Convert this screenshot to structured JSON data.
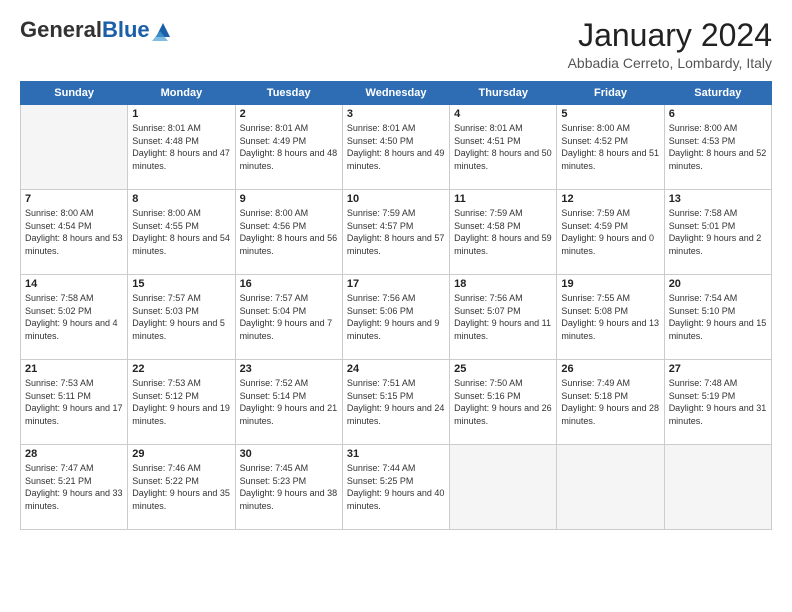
{
  "header": {
    "logo_general": "General",
    "logo_blue": "Blue",
    "month": "January 2024",
    "location": "Abbadia Cerreto, Lombardy, Italy"
  },
  "weekdays": [
    "Sunday",
    "Monday",
    "Tuesday",
    "Wednesday",
    "Thursday",
    "Friday",
    "Saturday"
  ],
  "weeks": [
    [
      {
        "day": "",
        "empty": true
      },
      {
        "day": "1",
        "sunrise": "Sunrise: 8:01 AM",
        "sunset": "Sunset: 4:48 PM",
        "daylight": "Daylight: 8 hours and 47 minutes."
      },
      {
        "day": "2",
        "sunrise": "Sunrise: 8:01 AM",
        "sunset": "Sunset: 4:49 PM",
        "daylight": "Daylight: 8 hours and 48 minutes."
      },
      {
        "day": "3",
        "sunrise": "Sunrise: 8:01 AM",
        "sunset": "Sunset: 4:50 PM",
        "daylight": "Daylight: 8 hours and 49 minutes."
      },
      {
        "day": "4",
        "sunrise": "Sunrise: 8:01 AM",
        "sunset": "Sunset: 4:51 PM",
        "daylight": "Daylight: 8 hours and 50 minutes."
      },
      {
        "day": "5",
        "sunrise": "Sunrise: 8:00 AM",
        "sunset": "Sunset: 4:52 PM",
        "daylight": "Daylight: 8 hours and 51 minutes."
      },
      {
        "day": "6",
        "sunrise": "Sunrise: 8:00 AM",
        "sunset": "Sunset: 4:53 PM",
        "daylight": "Daylight: 8 hours and 52 minutes."
      }
    ],
    [
      {
        "day": "7",
        "sunrise": "Sunrise: 8:00 AM",
        "sunset": "Sunset: 4:54 PM",
        "daylight": "Daylight: 8 hours and 53 minutes."
      },
      {
        "day": "8",
        "sunrise": "Sunrise: 8:00 AM",
        "sunset": "Sunset: 4:55 PM",
        "daylight": "Daylight: 8 hours and 54 minutes."
      },
      {
        "day": "9",
        "sunrise": "Sunrise: 8:00 AM",
        "sunset": "Sunset: 4:56 PM",
        "daylight": "Daylight: 8 hours and 56 minutes."
      },
      {
        "day": "10",
        "sunrise": "Sunrise: 7:59 AM",
        "sunset": "Sunset: 4:57 PM",
        "daylight": "Daylight: 8 hours and 57 minutes."
      },
      {
        "day": "11",
        "sunrise": "Sunrise: 7:59 AM",
        "sunset": "Sunset: 4:58 PM",
        "daylight": "Daylight: 8 hours and 59 minutes."
      },
      {
        "day": "12",
        "sunrise": "Sunrise: 7:59 AM",
        "sunset": "Sunset: 4:59 PM",
        "daylight": "Daylight: 9 hours and 0 minutes."
      },
      {
        "day": "13",
        "sunrise": "Sunrise: 7:58 AM",
        "sunset": "Sunset: 5:01 PM",
        "daylight": "Daylight: 9 hours and 2 minutes."
      }
    ],
    [
      {
        "day": "14",
        "sunrise": "Sunrise: 7:58 AM",
        "sunset": "Sunset: 5:02 PM",
        "daylight": "Daylight: 9 hours and 4 minutes."
      },
      {
        "day": "15",
        "sunrise": "Sunrise: 7:57 AM",
        "sunset": "Sunset: 5:03 PM",
        "daylight": "Daylight: 9 hours and 5 minutes."
      },
      {
        "day": "16",
        "sunrise": "Sunrise: 7:57 AM",
        "sunset": "Sunset: 5:04 PM",
        "daylight": "Daylight: 9 hours and 7 minutes."
      },
      {
        "day": "17",
        "sunrise": "Sunrise: 7:56 AM",
        "sunset": "Sunset: 5:06 PM",
        "daylight": "Daylight: 9 hours and 9 minutes."
      },
      {
        "day": "18",
        "sunrise": "Sunrise: 7:56 AM",
        "sunset": "Sunset: 5:07 PM",
        "daylight": "Daylight: 9 hours and 11 minutes."
      },
      {
        "day": "19",
        "sunrise": "Sunrise: 7:55 AM",
        "sunset": "Sunset: 5:08 PM",
        "daylight": "Daylight: 9 hours and 13 minutes."
      },
      {
        "day": "20",
        "sunrise": "Sunrise: 7:54 AM",
        "sunset": "Sunset: 5:10 PM",
        "daylight": "Daylight: 9 hours and 15 minutes."
      }
    ],
    [
      {
        "day": "21",
        "sunrise": "Sunrise: 7:53 AM",
        "sunset": "Sunset: 5:11 PM",
        "daylight": "Daylight: 9 hours and 17 minutes."
      },
      {
        "day": "22",
        "sunrise": "Sunrise: 7:53 AM",
        "sunset": "Sunset: 5:12 PM",
        "daylight": "Daylight: 9 hours and 19 minutes."
      },
      {
        "day": "23",
        "sunrise": "Sunrise: 7:52 AM",
        "sunset": "Sunset: 5:14 PM",
        "daylight": "Daylight: 9 hours and 21 minutes."
      },
      {
        "day": "24",
        "sunrise": "Sunrise: 7:51 AM",
        "sunset": "Sunset: 5:15 PM",
        "daylight": "Daylight: 9 hours and 24 minutes."
      },
      {
        "day": "25",
        "sunrise": "Sunrise: 7:50 AM",
        "sunset": "Sunset: 5:16 PM",
        "daylight": "Daylight: 9 hours and 26 minutes."
      },
      {
        "day": "26",
        "sunrise": "Sunrise: 7:49 AM",
        "sunset": "Sunset: 5:18 PM",
        "daylight": "Daylight: 9 hours and 28 minutes."
      },
      {
        "day": "27",
        "sunrise": "Sunrise: 7:48 AM",
        "sunset": "Sunset: 5:19 PM",
        "daylight": "Daylight: 9 hours and 31 minutes."
      }
    ],
    [
      {
        "day": "28",
        "sunrise": "Sunrise: 7:47 AM",
        "sunset": "Sunset: 5:21 PM",
        "daylight": "Daylight: 9 hours and 33 minutes."
      },
      {
        "day": "29",
        "sunrise": "Sunrise: 7:46 AM",
        "sunset": "Sunset: 5:22 PM",
        "daylight": "Daylight: 9 hours and 35 minutes."
      },
      {
        "day": "30",
        "sunrise": "Sunrise: 7:45 AM",
        "sunset": "Sunset: 5:23 PM",
        "daylight": "Daylight: 9 hours and 38 minutes."
      },
      {
        "day": "31",
        "sunrise": "Sunrise: 7:44 AM",
        "sunset": "Sunset: 5:25 PM",
        "daylight": "Daylight: 9 hours and 40 minutes."
      },
      {
        "day": "",
        "empty": true
      },
      {
        "day": "",
        "empty": true
      },
      {
        "day": "",
        "empty": true
      }
    ]
  ]
}
